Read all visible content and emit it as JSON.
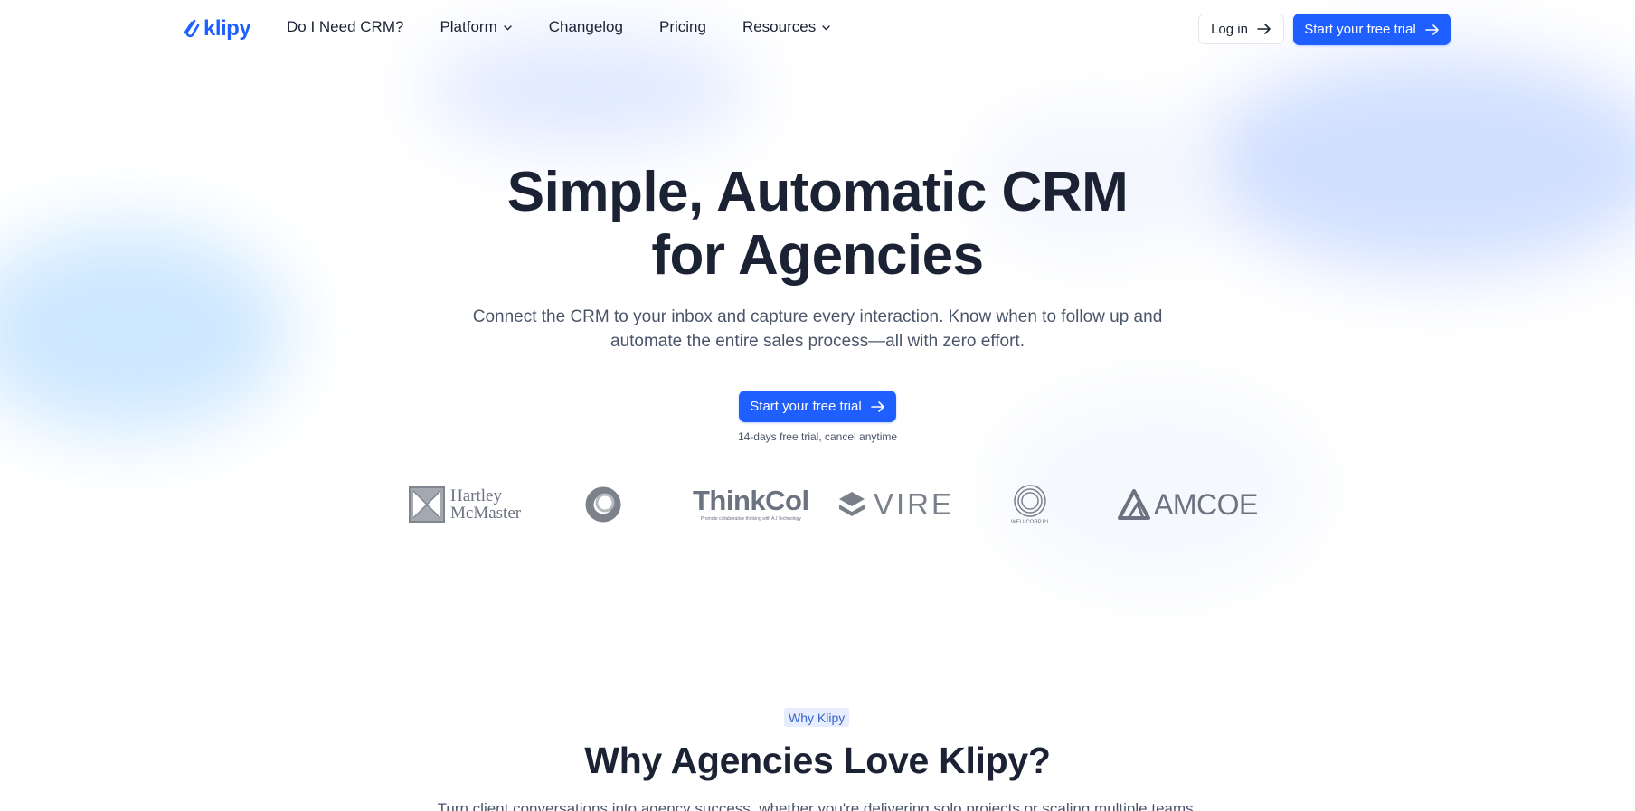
{
  "brand": {
    "name": "klipy",
    "color": "#1f5eff"
  },
  "nav": {
    "links": [
      {
        "label": "Do I Need CRM?",
        "dropdown": false
      },
      {
        "label": "Platform",
        "dropdown": true
      },
      {
        "label": "Changelog",
        "dropdown": false
      },
      {
        "label": "Pricing",
        "dropdown": false
      },
      {
        "label": "Resources",
        "dropdown": true
      }
    ],
    "login_label": "Log in",
    "trial_label": "Start your free trial"
  },
  "hero": {
    "title_line1": "Simple, Automatic CRM",
    "title_line2": "for Agencies",
    "subtitle_line1": "Connect the CRM to your inbox and capture every interaction. Know when to follow up and",
    "subtitle_line2": "automate the entire sales process—all with zero effort.",
    "cta_label": "Start your free trial",
    "note": "14-days free trial, cancel anytime"
  },
  "logos": {
    "hartley_line1": "Hartley",
    "hartley_line2": "McMaster",
    "thinkcol": "ThinkCol",
    "thinkcol_tagline": "Promote collaborative thinking with A.I Technology",
    "vire": "VIRE",
    "wellcorp": "WELLCORP.P1",
    "amcoe": "AMCOE"
  },
  "why": {
    "badge": "Why Klipy",
    "title": "Why Agencies Love Klipy?",
    "subtitle": "Turn client conversations into agency success, whether you're delivering solo projects or scaling multiple teams."
  },
  "icons": [
    "klipy-logo-icon",
    "chevron-down-icon",
    "arrow-right-icon"
  ]
}
